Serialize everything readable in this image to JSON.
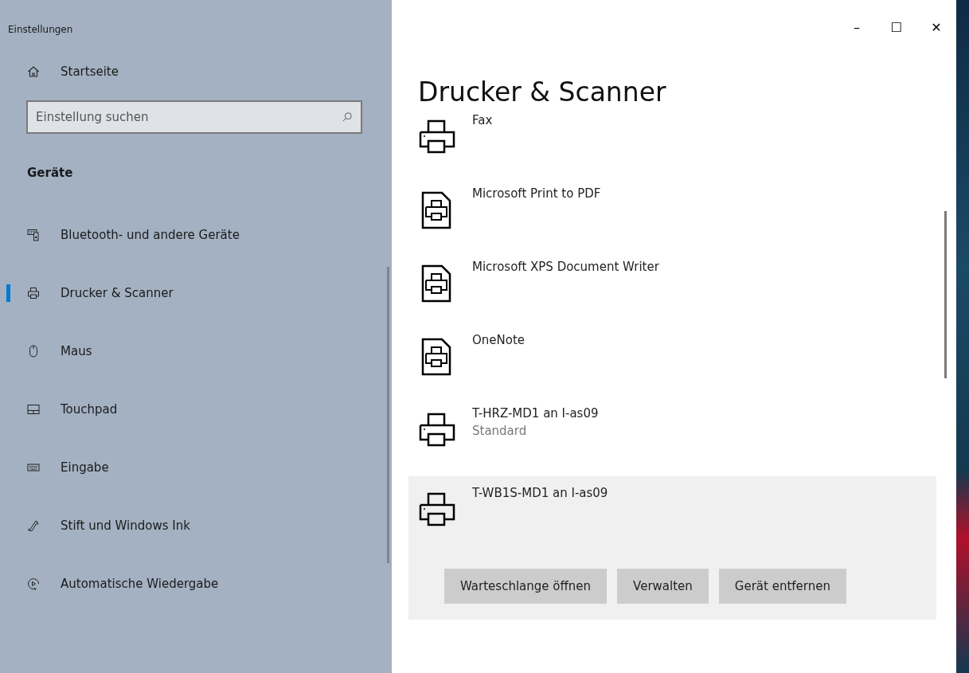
{
  "window": {
    "title": "Einstellungen",
    "controls": [
      "–",
      "☐",
      "✕"
    ]
  },
  "sidebar": {
    "home": {
      "label": "Startseite"
    },
    "search": {
      "placeholder": "Einstellung suchen"
    },
    "section": "Geräte",
    "items": [
      {
        "label": "Bluetooth- und andere Geräte",
        "kind": "bluetooth",
        "selected": false
      },
      {
        "label": "Drucker & Scanner",
        "kind": "printer",
        "selected": true
      },
      {
        "label": "Maus",
        "kind": "mouse",
        "selected": false
      },
      {
        "label": "Touchpad",
        "kind": "touchpad",
        "selected": false
      },
      {
        "label": "Eingabe",
        "kind": "keyboard",
        "selected": false
      },
      {
        "label": "Stift und Windows Ink",
        "kind": "pen",
        "selected": false
      },
      {
        "label": "Automatische Wiedergabe",
        "kind": "autoplay",
        "selected": false
      }
    ]
  },
  "main": {
    "title": "Drucker & Scanner",
    "printers": [
      {
        "name": "Fax",
        "kind": "printer",
        "selected": false
      },
      {
        "name": "Microsoft Print to PDF",
        "kind": "document",
        "selected": false
      },
      {
        "name": "Microsoft XPS Document Writer",
        "kind": "document",
        "selected": false
      },
      {
        "name": "OneNote",
        "kind": "document",
        "selected": false
      },
      {
        "name": "T-HRZ-MD1 an I-as09",
        "status": "Standard",
        "kind": "printer",
        "selected": false
      },
      {
        "name": "T-WB1S-MD1 an I-as09",
        "kind": "printer",
        "selected": true,
        "buttons": [
          "Warteschlange öffnen",
          "Verwalten",
          "Gerät entfernen"
        ]
      }
    ]
  }
}
